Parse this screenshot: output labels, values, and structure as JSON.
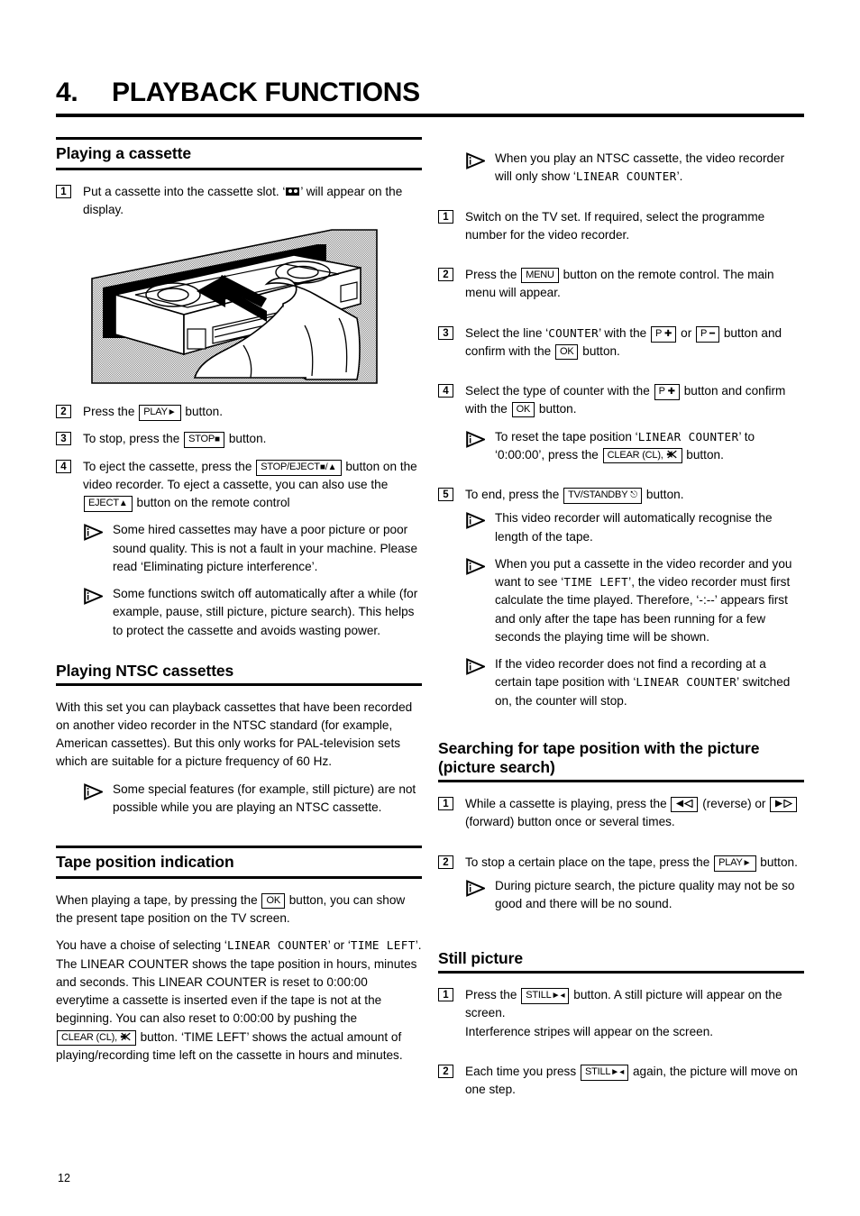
{
  "chapter": {
    "number": "4.",
    "title": "PLAYBACK FUNCTIONS"
  },
  "page_number": "12",
  "left_column": {
    "section_playing_cassette": {
      "heading": "Playing a cassette",
      "step1_a": "Put a cassette into the cassette slot. ‘",
      "step1_b": "’ will appear on the display.",
      "illustration_caption": "hand inserting VHS cassette into video recorder slot",
      "step2_a": "Press the",
      "step2_key": "PLAY",
      "step2_b": "button.",
      "step3_a": "To stop, press the",
      "step3_key": "STOP",
      "step3_b": "button.",
      "step4_a": "To eject the cassette, press the",
      "step4_key1": "STOP/EJECT",
      "step4_b": "button on the video recorder. To eject a cassette, you can also use the",
      "step4_key2": "EJECT",
      "step4_c": "button on the remote control",
      "note1": "Some hired cassettes may have a poor picture or poor sound quality. This is not a fault in your machine. Please read ‘Eliminating picture interference’.",
      "note2": "Some functions switch off automatically after a while (for example, pause, still picture, picture search). This helps to protect the cassette and avoids wasting power."
    },
    "section_ntsc": {
      "heading": "Playing NTSC cassettes",
      "para": "With this set you can playback cassettes that have been recorded on another video recorder in the NTSC standard (for example, American cassettes). But this only works for PAL-television sets which are suitable for a picture frequency of 60 Hz.",
      "note1": "Some special features (for example, still picture) are not possible while you are playing an NTSC cassette."
    },
    "section_tape_position": {
      "heading": "Tape position indication",
      "para1_a": "When playing a tape, by pressing the",
      "para1_key": "OK",
      "para1_b": "button, you can show the present tape position on the TV screen.",
      "para2_a": "You have a choise of selecting ‘",
      "para2_lcd1": "LINEAR COUNTER",
      "para2_b": "’ or ‘",
      "para2_lcd2": "TIME LEFT",
      "para2_c": "’. The LINEAR COUNTER shows the tape position in hours, minutes and seconds. This LINEAR COUNTER is reset to 0:00:00 everytime a cassette is inserted even if the tape is not at the beginning. You can also reset to 0:00:00 by pushing the",
      "para2_key": "CLEAR (CL),",
      "para2_d": "button. ‘TIME LEFT’ shows the actual amount of playing/recording time left on the cassette in hours and minutes."
    }
  },
  "right_column": {
    "note_top_a": "When you play an NTSC cassette, the video recorder will only show ‘",
    "note_top_lcd": "LINEAR COUNTER",
    "note_top_b": "’.",
    "step1": "Switch on the TV set. If required, select the programme number for the video recorder.",
    "step2_a": "Press the",
    "step2_key": "MENU",
    "step2_b": "button on the remote control. The main menu will appear.",
    "step3_a": "Select the line ‘",
    "step3_lcd": "COUNTER",
    "step3_b": "’ with the",
    "step3_key1": "P",
    "step3_c": "or",
    "step3_key2": "P",
    "step3_d": "button and confirm with the",
    "step3_key3": "OK",
    "step3_e": "button.",
    "step4_a": "Select the type of counter with the",
    "step4_key1": "P",
    "step4_b": "button and confirm with the",
    "step4_key2": "OK",
    "step4_c": "button.",
    "step4_note_a": "To reset the tape position ‘",
    "step4_note_lcd": "LINEAR COUNTER",
    "step4_note_b": "’ to ‘0:00:00’, press the",
    "step4_note_key": "CLEAR (CL),",
    "step4_note_c": "button.",
    "step5_a": "To end, press the",
    "step5_key": "TV/STANDBY",
    "step5_b": "button.",
    "step5_note1": "This video recorder will automatically recognise the length of the tape.",
    "step5_note2_a": "When you put a cassette in the video recorder and you want to see ‘",
    "step5_note2_lcd": "TIME LEFT",
    "step5_note2_b": "’, the video recorder must first calculate the time played. Therefore, ‘-:--’ appears first and only after the tape has been running for a few seconds the playing time will be shown.",
    "step5_note3_a": "If the video recorder does not find a recording at a certain tape position with ‘",
    "step5_note3_lcd": "LINEAR COUNTER",
    "step5_note3_b": "’ switched on, the counter will stop.",
    "section_picture_search": {
      "heading_line1": "Searching for tape position with the picture",
      "heading_line2": "(picture search)",
      "step1_a": "While a cassette is playing, press the",
      "step1_b": "(reverse) or",
      "step1_c": "(forward) button once or several times.",
      "step2_a": "To stop a certain place on the tape, press the",
      "step2_key": "PLAY",
      "step2_b": "button.",
      "step2_note": "During picture search, the picture quality may not be so good and there will be no sound."
    },
    "section_still_picture": {
      "heading": "Still picture",
      "step1_a": "Press the",
      "step1_key": "STILL",
      "step1_b": "button. A still picture will appear on the screen.",
      "step1_c": "Interference stripes will appear on the screen.",
      "step2_a": "Each time you press",
      "step2_key": "STILL",
      "step2_b": "again, the picture will move on one step."
    }
  }
}
